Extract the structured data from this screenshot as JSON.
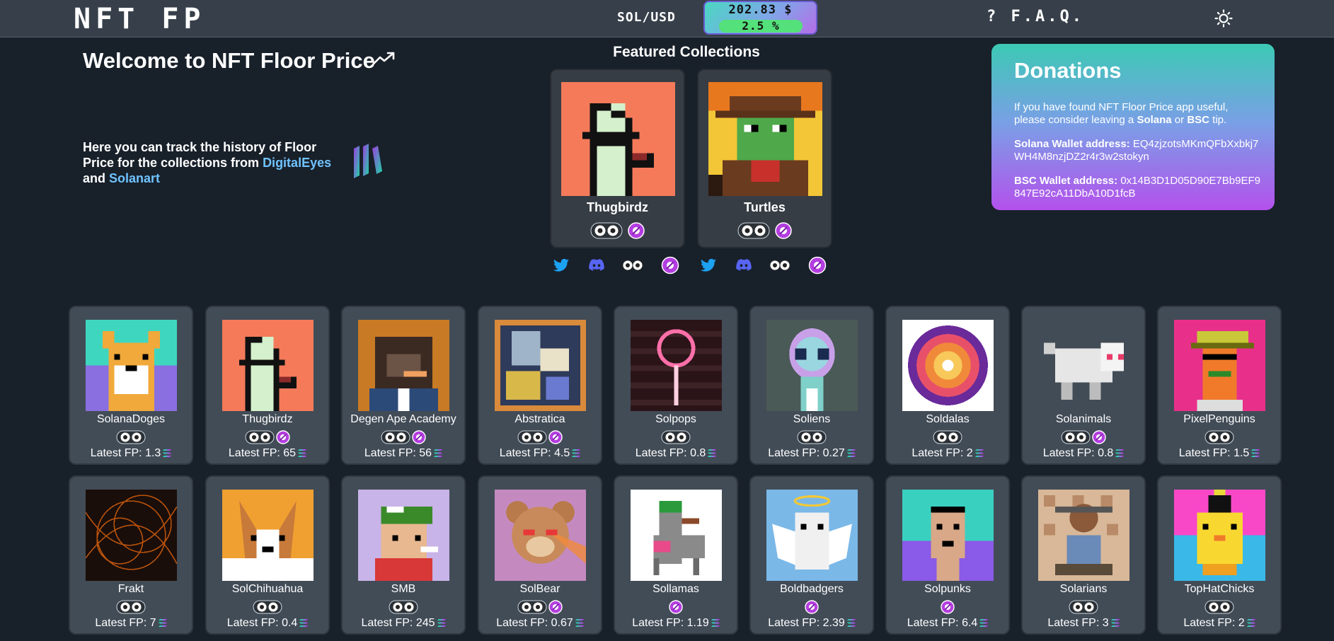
{
  "header": {
    "logo": "NFT FP",
    "pair_label": "SOL/USD",
    "price": "202.83 $",
    "change": "2.5 %",
    "faq": "? F.A.Q.",
    "theme_icon": "sun-icon"
  },
  "intro": {
    "welcome": "Welcome to NFT Floor Price",
    "text_before": "Here you can track the history of Floor Price for the collections from ",
    "link1": "DigitalEyes",
    "text_mid": "and ",
    "link2": "Solanart"
  },
  "featured": {
    "title": "Featured Collections",
    "items": [
      {
        "name": "Thugbirdz",
        "markets": [
          "digitaleyes",
          "solanart"
        ],
        "socials": [
          "twitter",
          "discord",
          "digitaleyes",
          "solanart"
        ]
      },
      {
        "name": "Turtles",
        "markets": [
          "digitaleyes",
          "solanart"
        ],
        "socials": [
          "twitter",
          "discord",
          "digitaleyes",
          "solanart"
        ]
      }
    ]
  },
  "donations": {
    "title": "Donations",
    "text1": "If you have found NFT Floor Price app useful, please consider leaving a ",
    "text_sol": "Solana",
    "text_or": " or ",
    "text_bsc": "BSC",
    "text_end": " tip.",
    "sol_label": "Solana Wallet address:",
    "sol_address": "EQ4zjzotsMKmQFbXxbkj7WH4M8nzjDZ2r4r3w2stokyn",
    "bsc_label": "BSC Wallet address:",
    "bsc_address": "0x14B3D1D05D90E7Bb9EF9847E92cA11DbA10D1fcB"
  },
  "grid": {
    "fp_prefix": "Latest FP: ",
    "rows": [
      [
        {
          "name": "SolanaDoges",
          "fp": "1.3",
          "markets": [
            "digitaleyes"
          ]
        },
        {
          "name": "Thugbirdz",
          "fp": "65",
          "markets": [
            "digitaleyes",
            "solanart"
          ]
        },
        {
          "name": "Degen Ape Academy",
          "fp": "56",
          "markets": [
            "digitaleyes",
            "solanart"
          ]
        },
        {
          "name": "Abstratica",
          "fp": "4.5",
          "markets": [
            "digitaleyes",
            "solanart"
          ]
        },
        {
          "name": "Solpops",
          "fp": "0.8",
          "markets": [
            "digitaleyes"
          ]
        },
        {
          "name": "Soliens",
          "fp": "0.27",
          "markets": [
            "digitaleyes"
          ]
        },
        {
          "name": "Soldalas",
          "fp": "2",
          "markets": [
            "digitaleyes"
          ]
        },
        {
          "name": "Solanimals",
          "fp": "0.8",
          "markets": [
            "digitaleyes",
            "solanart"
          ]
        },
        {
          "name": "PixelPenguins",
          "fp": "1.5",
          "markets": [
            "digitaleyes"
          ]
        }
      ],
      [
        {
          "name": "Frakt",
          "fp": "7",
          "markets": [
            "digitaleyes"
          ]
        },
        {
          "name": "SolChihuahua",
          "fp": "0.4",
          "markets": [
            "digitaleyes"
          ]
        },
        {
          "name": "SMB",
          "fp": "245",
          "markets": [
            "digitaleyes"
          ]
        },
        {
          "name": "SolBear",
          "fp": "0.67",
          "markets": [
            "digitaleyes",
            "solanart"
          ]
        },
        {
          "name": "Sollamas",
          "fp": "1.19",
          "markets": [
            "solanart"
          ]
        },
        {
          "name": "Boldbadgers",
          "fp": "2.39",
          "markets": [
            "solanart"
          ]
        },
        {
          "name": "Solpunks",
          "fp": "6.4",
          "markets": [
            "solanart"
          ]
        },
        {
          "name": "Solarians",
          "fp": "3",
          "markets": [
            "digitaleyes"
          ]
        },
        {
          "name": "TopHatChicks",
          "fp": "2",
          "markets": [
            "digitaleyes"
          ]
        }
      ]
    ]
  },
  "colors": {
    "background": "#18202a",
    "header": "#37404a",
    "card": "#424c57",
    "link": "#6fc3ff",
    "solanart": "#b43de0",
    "twitter": "#1da1f2",
    "discord": "#5865f2"
  }
}
